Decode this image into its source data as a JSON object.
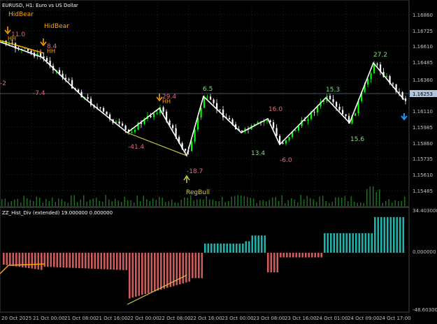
{
  "symbol_label": "EURUSD, H1:  Euro vs US Dollar",
  "indicator_label": "ZZ_Hist_Div (extended) 19.000000 0.000000",
  "colors": {
    "bg": "#000000",
    "grid": "#1c2a1c",
    "axis_text": "#c0c0c0",
    "candle_up": "#00ff00",
    "candle_down": "#ffffff",
    "zigzag": "#ffffff",
    "div_line_bear": "#ffa500",
    "div_line_bull": "#d2c84a",
    "label_green": "#7ee07e",
    "label_red": "#e06c7e",
    "label_orange": "#ffa500",
    "bar_red": "#cd5c5c",
    "bar_teal": "#20b2aa",
    "volume": "#1f6b1f",
    "price_marker_bg": "#b0c4de",
    "arrow_blue": "#1e90ff"
  },
  "price_axis": [
    "1.16860",
    "1.16725",
    "1.16610",
    "1.16485",
    "1.16360",
    "1.16110",
    "1.15985",
    "1.15860",
    "1.15735",
    "1.15610",
    "1.15485"
  ],
  "current_price": "1.16253",
  "time_axis": [
    "20 Oct 2025",
    "21 Oct 00:00",
    "21 Oct 08:00",
    "21 Oct 16:00",
    "22 Oct 00:00",
    "22 Oct 08:00",
    "22 Oct 16:00",
    "23 Oct 00:00",
    "23 Oct 08:00",
    "23 Oct 16:00",
    "24 Oct 01:00",
    "24 Oct 09:00",
    "24 Oct 17:00"
  ],
  "indicator_axis": [
    "34.403000",
    "0.000000",
    "-48.603000"
  ],
  "zigzag_labels": [
    {
      "text": "11.0",
      "color": "label_red"
    },
    {
      "text": "-2",
      "color": "label_red"
    },
    {
      "text": "8.4",
      "color": "label_red"
    },
    {
      "text": "-7.4",
      "color": "label_red"
    },
    {
      "text": "29.4",
      "color": "label_red"
    },
    {
      "text": "-41.4",
      "color": "label_red"
    },
    {
      "text": "6.5",
      "color": "label_green"
    },
    {
      "text": "-18.7",
      "color": "label_red"
    },
    {
      "text": "13.4",
      "color": "label_green"
    },
    {
      "text": "16.0",
      "color": "label_red"
    },
    {
      "text": "-6.0",
      "color": "label_red"
    },
    {
      "text": "15.3",
      "color": "label_green"
    },
    {
      "text": "15.6",
      "color": "label_green"
    },
    {
      "text": "27.2",
      "color": "label_green"
    }
  ],
  "signal_labels": {
    "hidbear_1": "HidBear",
    "hidbear_2": "HidBear",
    "hh_1": "HH",
    "hh_2": "HH",
    "hh_3": "HH",
    "regbull": "RegBull"
  }
}
